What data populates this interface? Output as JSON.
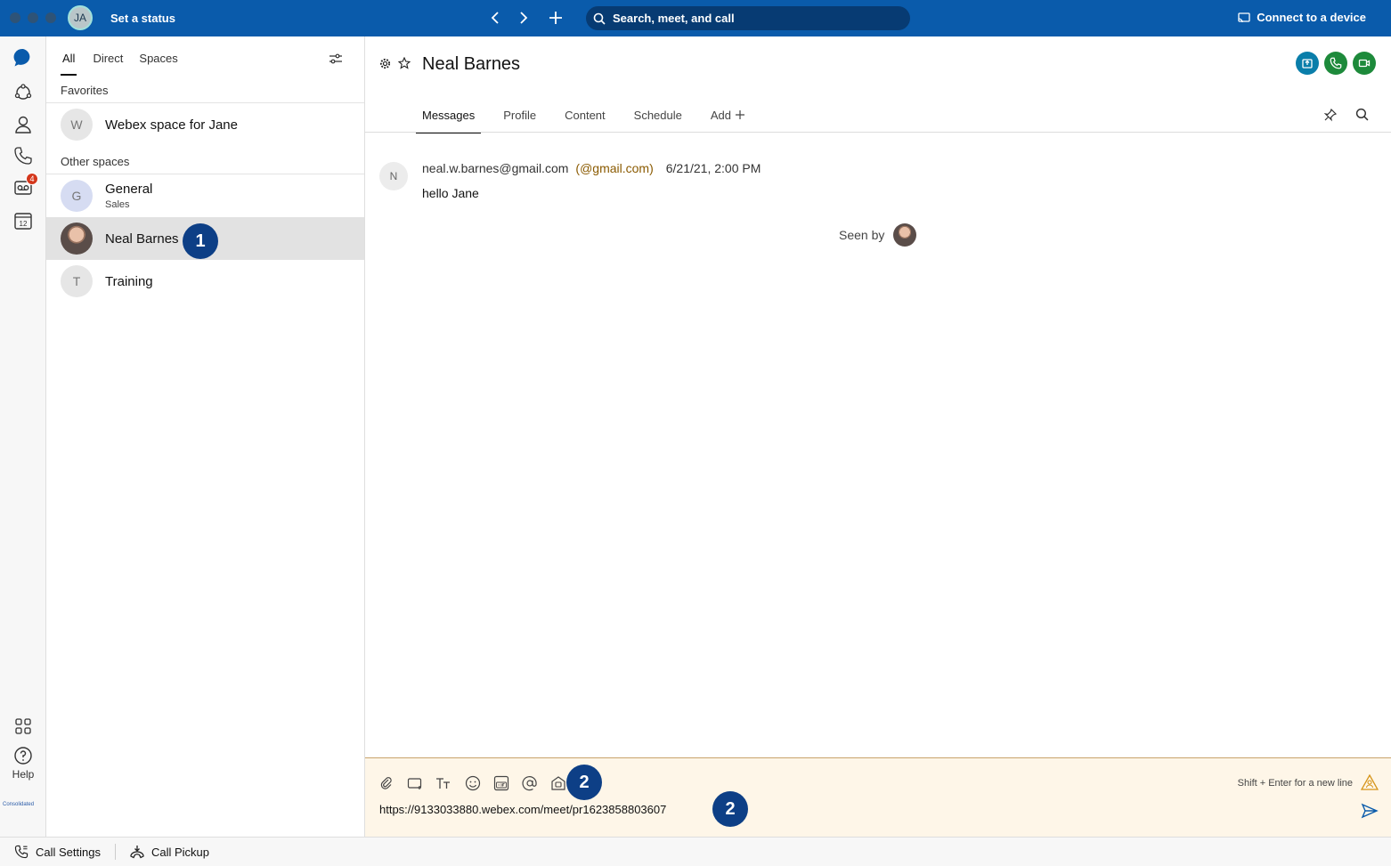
{
  "topbar": {
    "avatar_initials": "JA",
    "status_text": "Set a status",
    "search_placeholder": "Search, meet, and call",
    "connect_label": "Connect to a device"
  },
  "rail": {
    "voicemail_badge": "4",
    "calendar_day": "12",
    "help_label": "Help",
    "brand_text": "Consolidated"
  },
  "list": {
    "tabs": [
      "All",
      "Direct",
      "Spaces"
    ],
    "favorites_label": "Favorites",
    "other_label": "Other spaces",
    "items": [
      {
        "initial": "W",
        "title": "Webex space for Jane",
        "subtitle": ""
      },
      {
        "initial": "G",
        "title": "General",
        "subtitle": "Sales"
      },
      {
        "initial": "",
        "title": "Neal Barnes",
        "subtitle": ""
      },
      {
        "initial": "T",
        "title": "Training",
        "subtitle": ""
      }
    ]
  },
  "callouts": [
    "1",
    "2",
    "2"
  ],
  "main": {
    "title": "Neal Barnes",
    "tabs": [
      "Messages",
      "Profile",
      "Content",
      "Schedule",
      "Add"
    ],
    "message": {
      "avatar_initial": "N",
      "sender": "neal.w.barnes@gmail.com",
      "org": "(@gmail.com)",
      "time": "6/21/21, 2:00 PM",
      "body": "hello Jane"
    },
    "seen_by_label": "Seen by"
  },
  "composer": {
    "hint": "Shift + Enter for a new line",
    "value": "https://9133033880.webex.com/meet/pr1623858803607"
  },
  "bottombar": {
    "call_settings": "Call Settings",
    "call_pickup": "Call Pickup"
  },
  "colors": {
    "topbar": "#0a5bab",
    "accent_blue": "#005e7d",
    "call_green": "#1d8a3b",
    "callout": "#0d3f86",
    "badge_red": "#d4371c",
    "composer_bg": "#fef6e8"
  }
}
